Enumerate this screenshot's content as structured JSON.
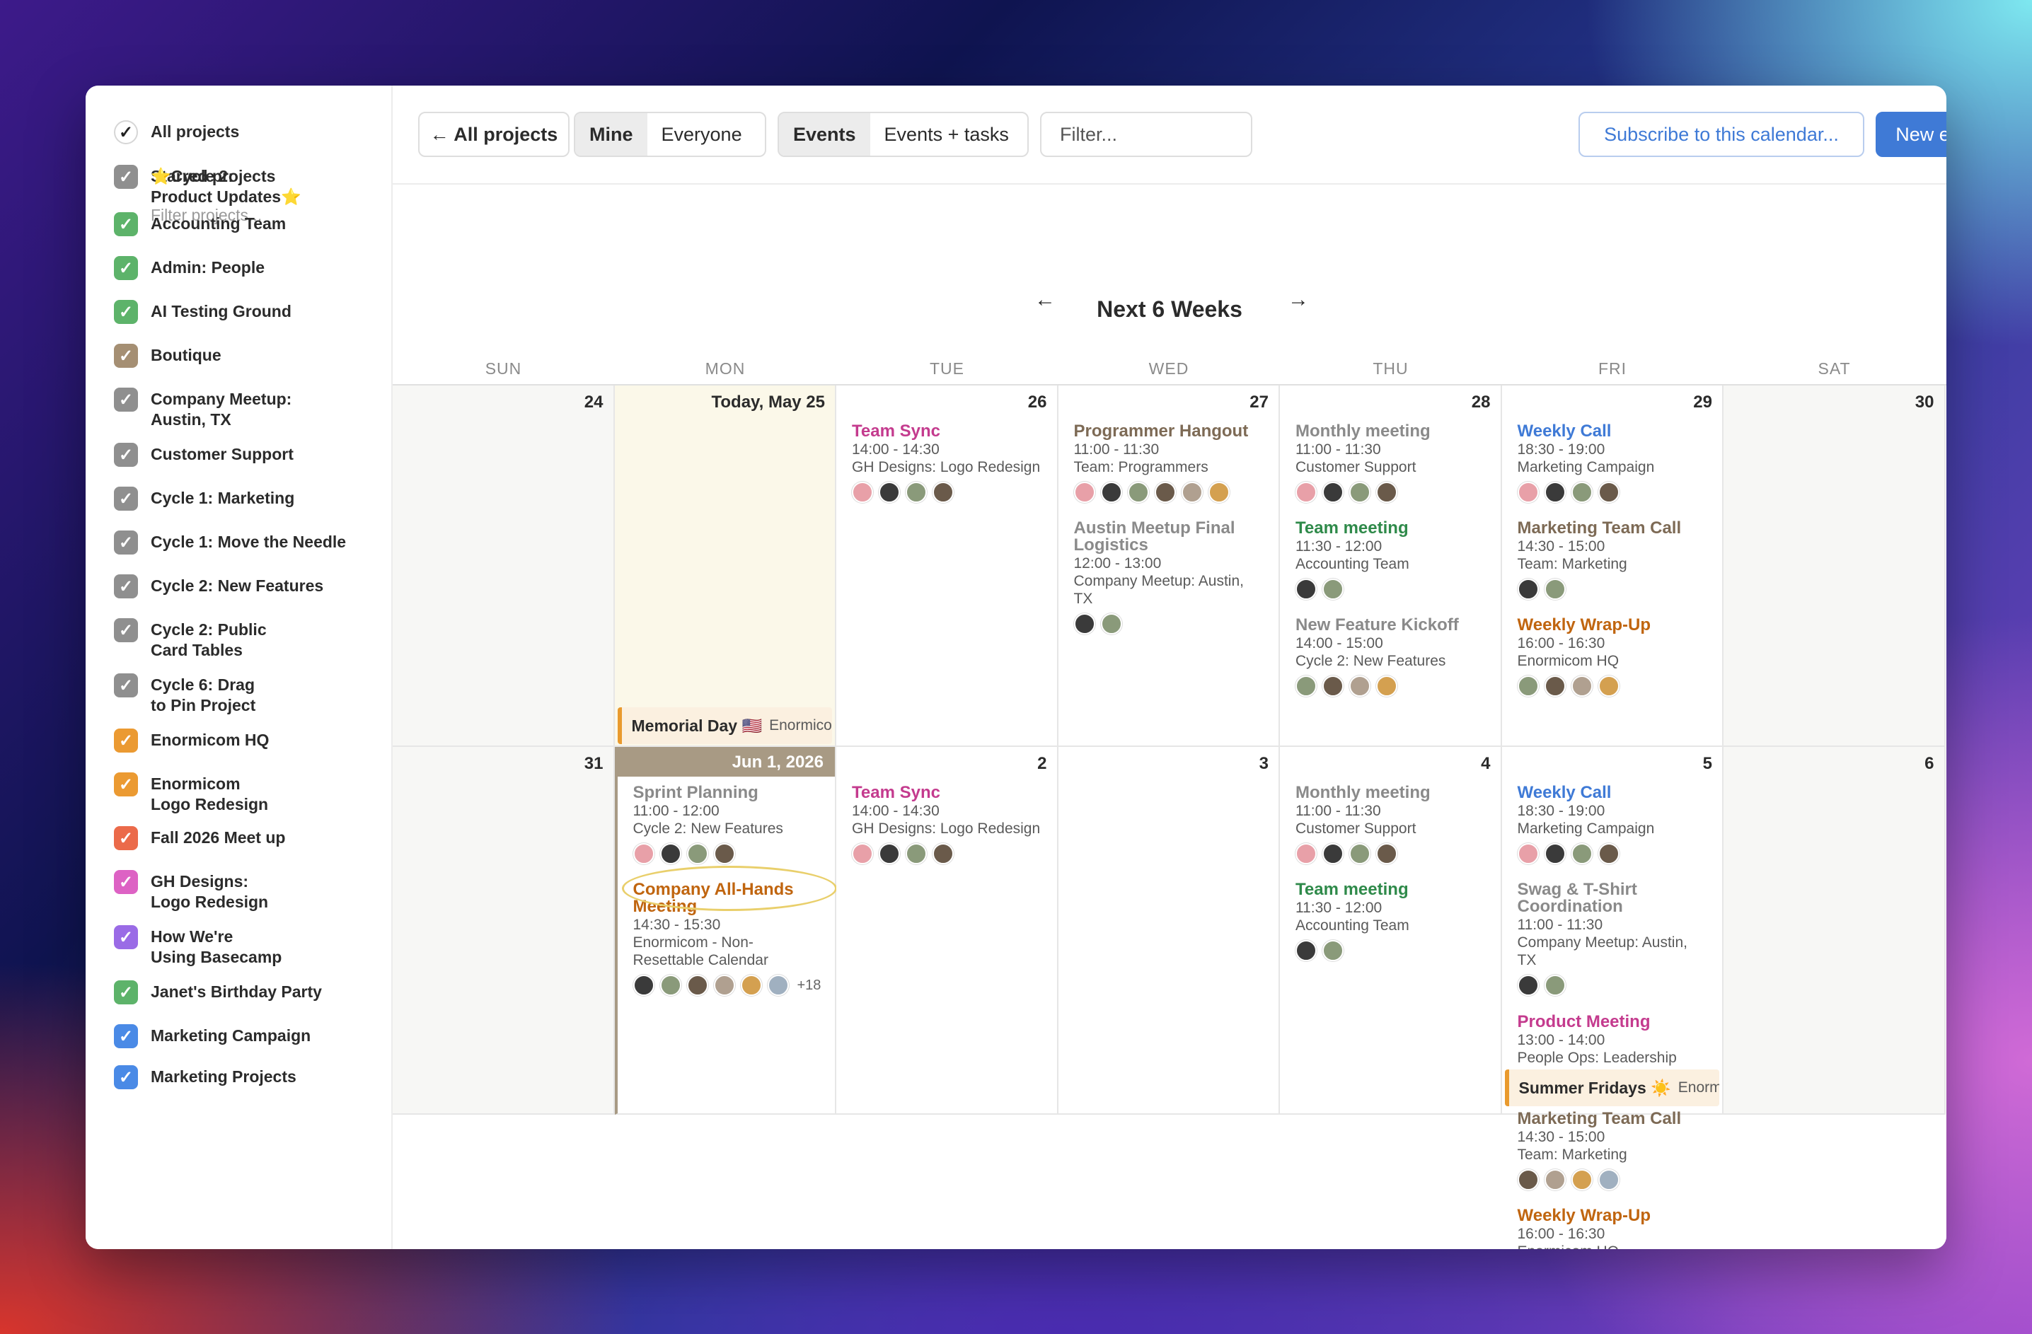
{
  "colors": {
    "blue": "#3f7ad6",
    "pink": "#c43b8e",
    "brown": "#7d6a55",
    "green": "#2f8a4a",
    "orange": "#c0650f",
    "gray": "#8a8a8a"
  },
  "sidebar": {
    "all_projects": "All projects",
    "starred_projects": "Starred projects",
    "filter_placeholder": "Filter projects...",
    "projects": [
      {
        "label1": "⭐Cycle 2:",
        "label2": "Product Updates⭐",
        "color": "#8f8f8f"
      },
      {
        "label1": "Accounting Team",
        "color": "#5db36a"
      },
      {
        "label1": "Admin: People",
        "color": "#5db36a"
      },
      {
        "label1": "AI Testing Ground",
        "color": "#5db36a"
      },
      {
        "label1": "Boutique",
        "color": "#a58f73"
      },
      {
        "label1": "Company Meetup:",
        "label2": "Austin, TX",
        "color": "#8f8f8f"
      },
      {
        "label1": "Customer Support",
        "color": "#8f8f8f"
      },
      {
        "label1": "Cycle 1: Marketing",
        "color": "#8f8f8f"
      },
      {
        "label1": "Cycle 1: Move the Needle",
        "color": "#8f8f8f"
      },
      {
        "label1": "Cycle 2: New Features",
        "color": "#8f8f8f"
      },
      {
        "label1": "Cycle 2: Public",
        "label2": "Card Tables",
        "color": "#8f8f8f"
      },
      {
        "label1": "Cycle 6: Drag",
        "label2": "to Pin Project",
        "color": "#8f8f8f"
      },
      {
        "label1": "Enormicom HQ",
        "color": "#eb9a32"
      },
      {
        "label1": "Enormicom",
        "label2": "Logo Redesign",
        "color": "#eb9a32"
      },
      {
        "label1": "Fall 2026 Meet up",
        "color": "#eb6a4a"
      },
      {
        "label1": "GH Designs:",
        "label2": "Logo Redesign",
        "color": "#dd62c4"
      },
      {
        "label1": "How We're",
        "label2": "Using Basecamp",
        "color": "#9a6be6"
      },
      {
        "label1": "Janet's Birthday Party",
        "color": "#5db36a"
      },
      {
        "label1": "Marketing Campaign",
        "color": "#4a8ae6"
      },
      {
        "label1": "Marketing Projects",
        "color": "#4a8ae6"
      }
    ]
  },
  "toolbar": {
    "all_projects": "← All projects",
    "mine": "Mine",
    "everyone": "Everyone",
    "events": "Events",
    "events_tasks": "Events + tasks",
    "filter_placeholder": "Filter...",
    "subscribe": "Subscribe to this calendar...",
    "new_event": "New event"
  },
  "calendar": {
    "title": "Next 6 Weeks",
    "prev": "←",
    "next": "→",
    "weekdays": [
      "SUN",
      "MON",
      "TUE",
      "WED",
      "THU",
      "FRI",
      "SAT"
    ],
    "week1": {
      "d0": "24",
      "d1": "Today, May 25",
      "d2": "26",
      "d3": "27",
      "d4": "28",
      "d5": "29",
      "d6": "30",
      "memorial": {
        "title": "Memorial Day 🇺🇸",
        "project": "Enormicom HQ"
      },
      "tue": [
        {
          "title": "Team Sync",
          "time": "14:00 - 14:30",
          "project": "GH Designs: Logo Redesign"
        }
      ],
      "wed": [
        {
          "title": "Programmer Hangout",
          "time": "11:00 - 11:30",
          "project": "Team: Programmers"
        },
        {
          "title": "Austin Meetup Final",
          "title2": "Logistics",
          "time": "12:00 - 13:00",
          "project": "Company Meetup: Austin,",
          "project2": "TX"
        }
      ],
      "thu": [
        {
          "title": "Monthly meeting",
          "time": "11:00 - 11:30",
          "project": "Customer Support"
        },
        {
          "title": "Team meeting",
          "time": "11:30 - 12:00",
          "project": "Accounting Team"
        },
        {
          "title": "New Feature Kickoff",
          "time": "14:00 - 15:00",
          "project": "Cycle 2: New Features"
        }
      ],
      "fri": [
        {
          "title": "Weekly Call",
          "time": "18:30 - 19:00",
          "project": "Marketing Campaign"
        },
        {
          "title": "Marketing Team Call",
          "time": "14:30 - 15:00",
          "project": "Team: Marketing"
        },
        {
          "title": "Weekly Wrap-Up",
          "time": "16:00 - 16:30",
          "project": "Enormicom HQ"
        }
      ]
    },
    "week2": {
      "d0": "31",
      "d1": "Jun 1, 2026",
      "d2": "2",
      "d3": "3",
      "d4": "4",
      "d5": "5",
      "d6": "6",
      "mon": [
        {
          "title": "Sprint Planning",
          "time": "11:00 - 12:00",
          "project": "Cycle 2: New Features"
        },
        {
          "title": "Company All-Hands",
          "title2": "Meeting",
          "time": "14:30 - 15:30",
          "project": "Enormicom - Non-",
          "project2": "Resettable Calendar",
          "more": "+18"
        }
      ],
      "tue": [
        {
          "title": "Team Sync",
          "time": "14:00 - 14:30",
          "project": "GH Designs: Logo Redesign"
        }
      ],
      "thu": [
        {
          "title": "Monthly meeting",
          "time": "11:00 - 11:30",
          "project": "Customer Support"
        },
        {
          "title": "Team meeting",
          "time": "11:30 - 12:00",
          "project": "Accounting Team"
        }
      ],
      "fri": [
        {
          "title": "Weekly Call",
          "time": "18:30 - 19:00",
          "project": "Marketing Campaign"
        },
        {
          "title": "Swag & T-Shirt",
          "title2": "Coordination",
          "time": "11:00 - 11:30",
          "project": "Company Meetup: Austin,",
          "project2": "TX"
        },
        {
          "title": "Product Meeting",
          "time": "13:00 - 14:00",
          "project": "People Ops: Leadership"
        },
        {
          "title": "Marketing Team Call",
          "time": "14:30 - 15:00",
          "project": "Team: Marketing"
        },
        {
          "title": "Weekly Wrap-Up",
          "time": "16:00 - 16:30",
          "project": "Enormicom HQ"
        }
      ],
      "summer": {
        "title": "Summer Fridays ☀️",
        "project": "Enormicom HQ"
      }
    }
  }
}
